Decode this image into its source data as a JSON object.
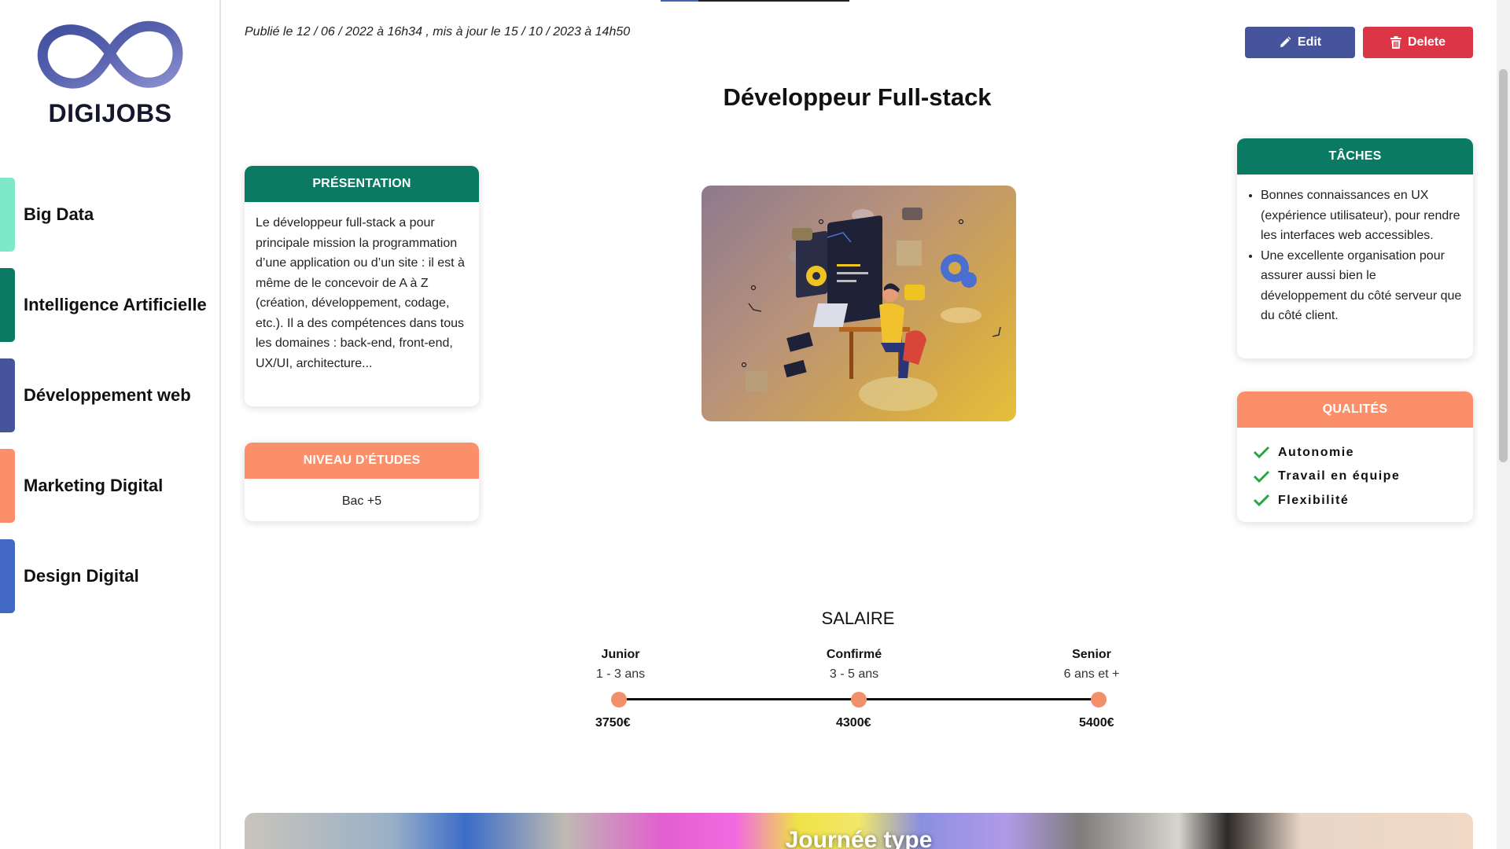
{
  "brand": {
    "name": "DIGIJOBS",
    "logo_icon": "infinity-logo-icon"
  },
  "sidebar": {
    "items": [
      {
        "label": "Big Data",
        "color": "#7ee8c7"
      },
      {
        "label": "Intelligence Artificielle",
        "color": "#0b7a62"
      },
      {
        "label": "Développement web",
        "color": "#45549b"
      },
      {
        "label": "Marketing Digital",
        "color": "#fb8f6a"
      },
      {
        "label": "Design Digital",
        "color": "#4169c4"
      }
    ]
  },
  "header": {
    "meta": "Publié le 12 / 06 / 2022 à 16h34 , mis à jour le 15 / 10 / 2023 à 14h50",
    "edit_label": "Edit",
    "delete_label": "Delete"
  },
  "job": {
    "title": "Développeur Full-stack",
    "presentation": {
      "heading": "PRÉSENTATION",
      "text": "Le développeur full-stack a pour principale mission la programmation d’une application ou d’un site : il est à même de le concevoir de A à Z (création, développement, codage, etc.). Il a des compétences dans tous les domaines : back-end, front-end, UX/UI, architecture..."
    },
    "niveau": {
      "heading": "NIVEAU D’ÉTUDES",
      "value": "Bac +5"
    },
    "taches": {
      "heading": "TÂCHES",
      "items": [
        "Bonnes connaissances en UX (expérience utilisateur), pour rendre les interfaces web accessibles.",
        "Une excellente organisation pour assurer aussi bien le développement du côté serveur que du côté client."
      ]
    },
    "qualites": {
      "heading": "QUALITÉS",
      "items": [
        "Autonomie",
        "Travail en équipe",
        "Flexibilité"
      ]
    }
  },
  "salary": {
    "title": "SALAIRE",
    "levels": [
      {
        "level": "Junior",
        "years": "1 - 3 ans",
        "amount": "3750€"
      },
      {
        "level": "Confirmé",
        "years": "3 - 5 ans",
        "amount": "4300€"
      },
      {
        "level": "Senior",
        "years": "6 ans et +",
        "amount": "5400€"
      }
    ]
  },
  "banner": {
    "title": "Journée type"
  },
  "colors": {
    "green": "#0b7a62",
    "orange": "#fb8f6a",
    "edit": "#45549b",
    "delete": "#dc3545",
    "salary_dot": "#f3906c"
  }
}
